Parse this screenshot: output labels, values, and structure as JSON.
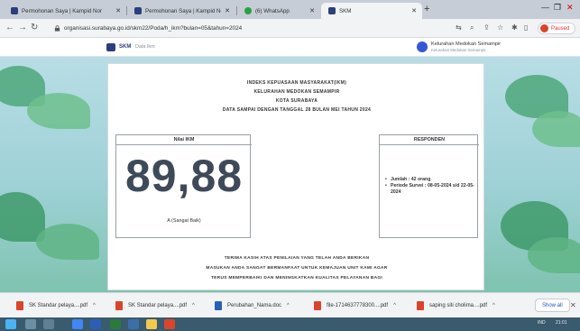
{
  "browser": {
    "tabs": [
      {
        "title": "Permohonan Saya | Kampid Nor",
        "active": false
      },
      {
        "title": "Permohonan Saya | Kampid Nor",
        "active": false
      },
      {
        "title": "(6) WhatsApp",
        "active": false
      },
      {
        "title": "SKM",
        "active": true
      }
    ],
    "address": "organisasi.surabaya.go.id/skm22/Poda/h_ikm?bulan=05&tahun=2024",
    "profile_label": "Paused",
    "window_controls": [
      "—",
      "❐",
      "✕"
    ]
  },
  "app": {
    "name": "SKM",
    "breadcrumb": "Data Ikm",
    "user_name": "Kelurahan Medokan Semampir",
    "user_role": "Kelurahan Medokan Semampir"
  },
  "report": {
    "header_lines": [
      "INDEKS KEPUASAAN MASYARAKAT(IKM)",
      "KELURAHAN MEDOKAN SEMAMPIR",
      "KOTA SURABAYA",
      "DATA SAMPAI DENGAN TANGGAL 28 BULAN MEI TAHUN 2024"
    ],
    "nilai_title": "Nilai IKM",
    "nilai_value": "89,88",
    "nilai_mutu": "A (Sangat Baik)",
    "responden_title": "RESPONDEN",
    "responden_items": [
      "Jumlah : 42 orang",
      "Periode Survei : 08-05-2024 s/d 22-05-2024"
    ],
    "footer_lines": [
      "TERIMA KASIH ATAS PENILAIAN YANG TELAH ANDA BERIKAN",
      "MASUKAN ANDA SANGAT BERMANFAAT UNTUK KEMAJUAN UNIT KAMI AGAR",
      "TERUS MEMPERBAIKI DAN MENINGKATKAN KUALITAS PELAYANAN BAGI"
    ]
  },
  "downloads": {
    "items": [
      {
        "name": "SK Standar pelaya....pdf",
        "type": "pdf"
      },
      {
        "name": "SK Standar pelaya....pdf",
        "type": "pdf"
      },
      {
        "name": "Perubahan_Nama.doc",
        "type": "doc"
      },
      {
        "name": "file-1714637778300....pdf",
        "type": "pdf"
      },
      {
        "name": "saping siti cholima....pdf",
        "type": "pdf"
      }
    ],
    "show_all_label": "Show all"
  },
  "taskbar": {
    "tray_lang": "IND",
    "clock": "21:01"
  },
  "colors": {
    "accent": "#2d3e7c",
    "pdf": "#d9452b",
    "doc": "#2b5fb7",
    "score": "#3f4a58"
  }
}
